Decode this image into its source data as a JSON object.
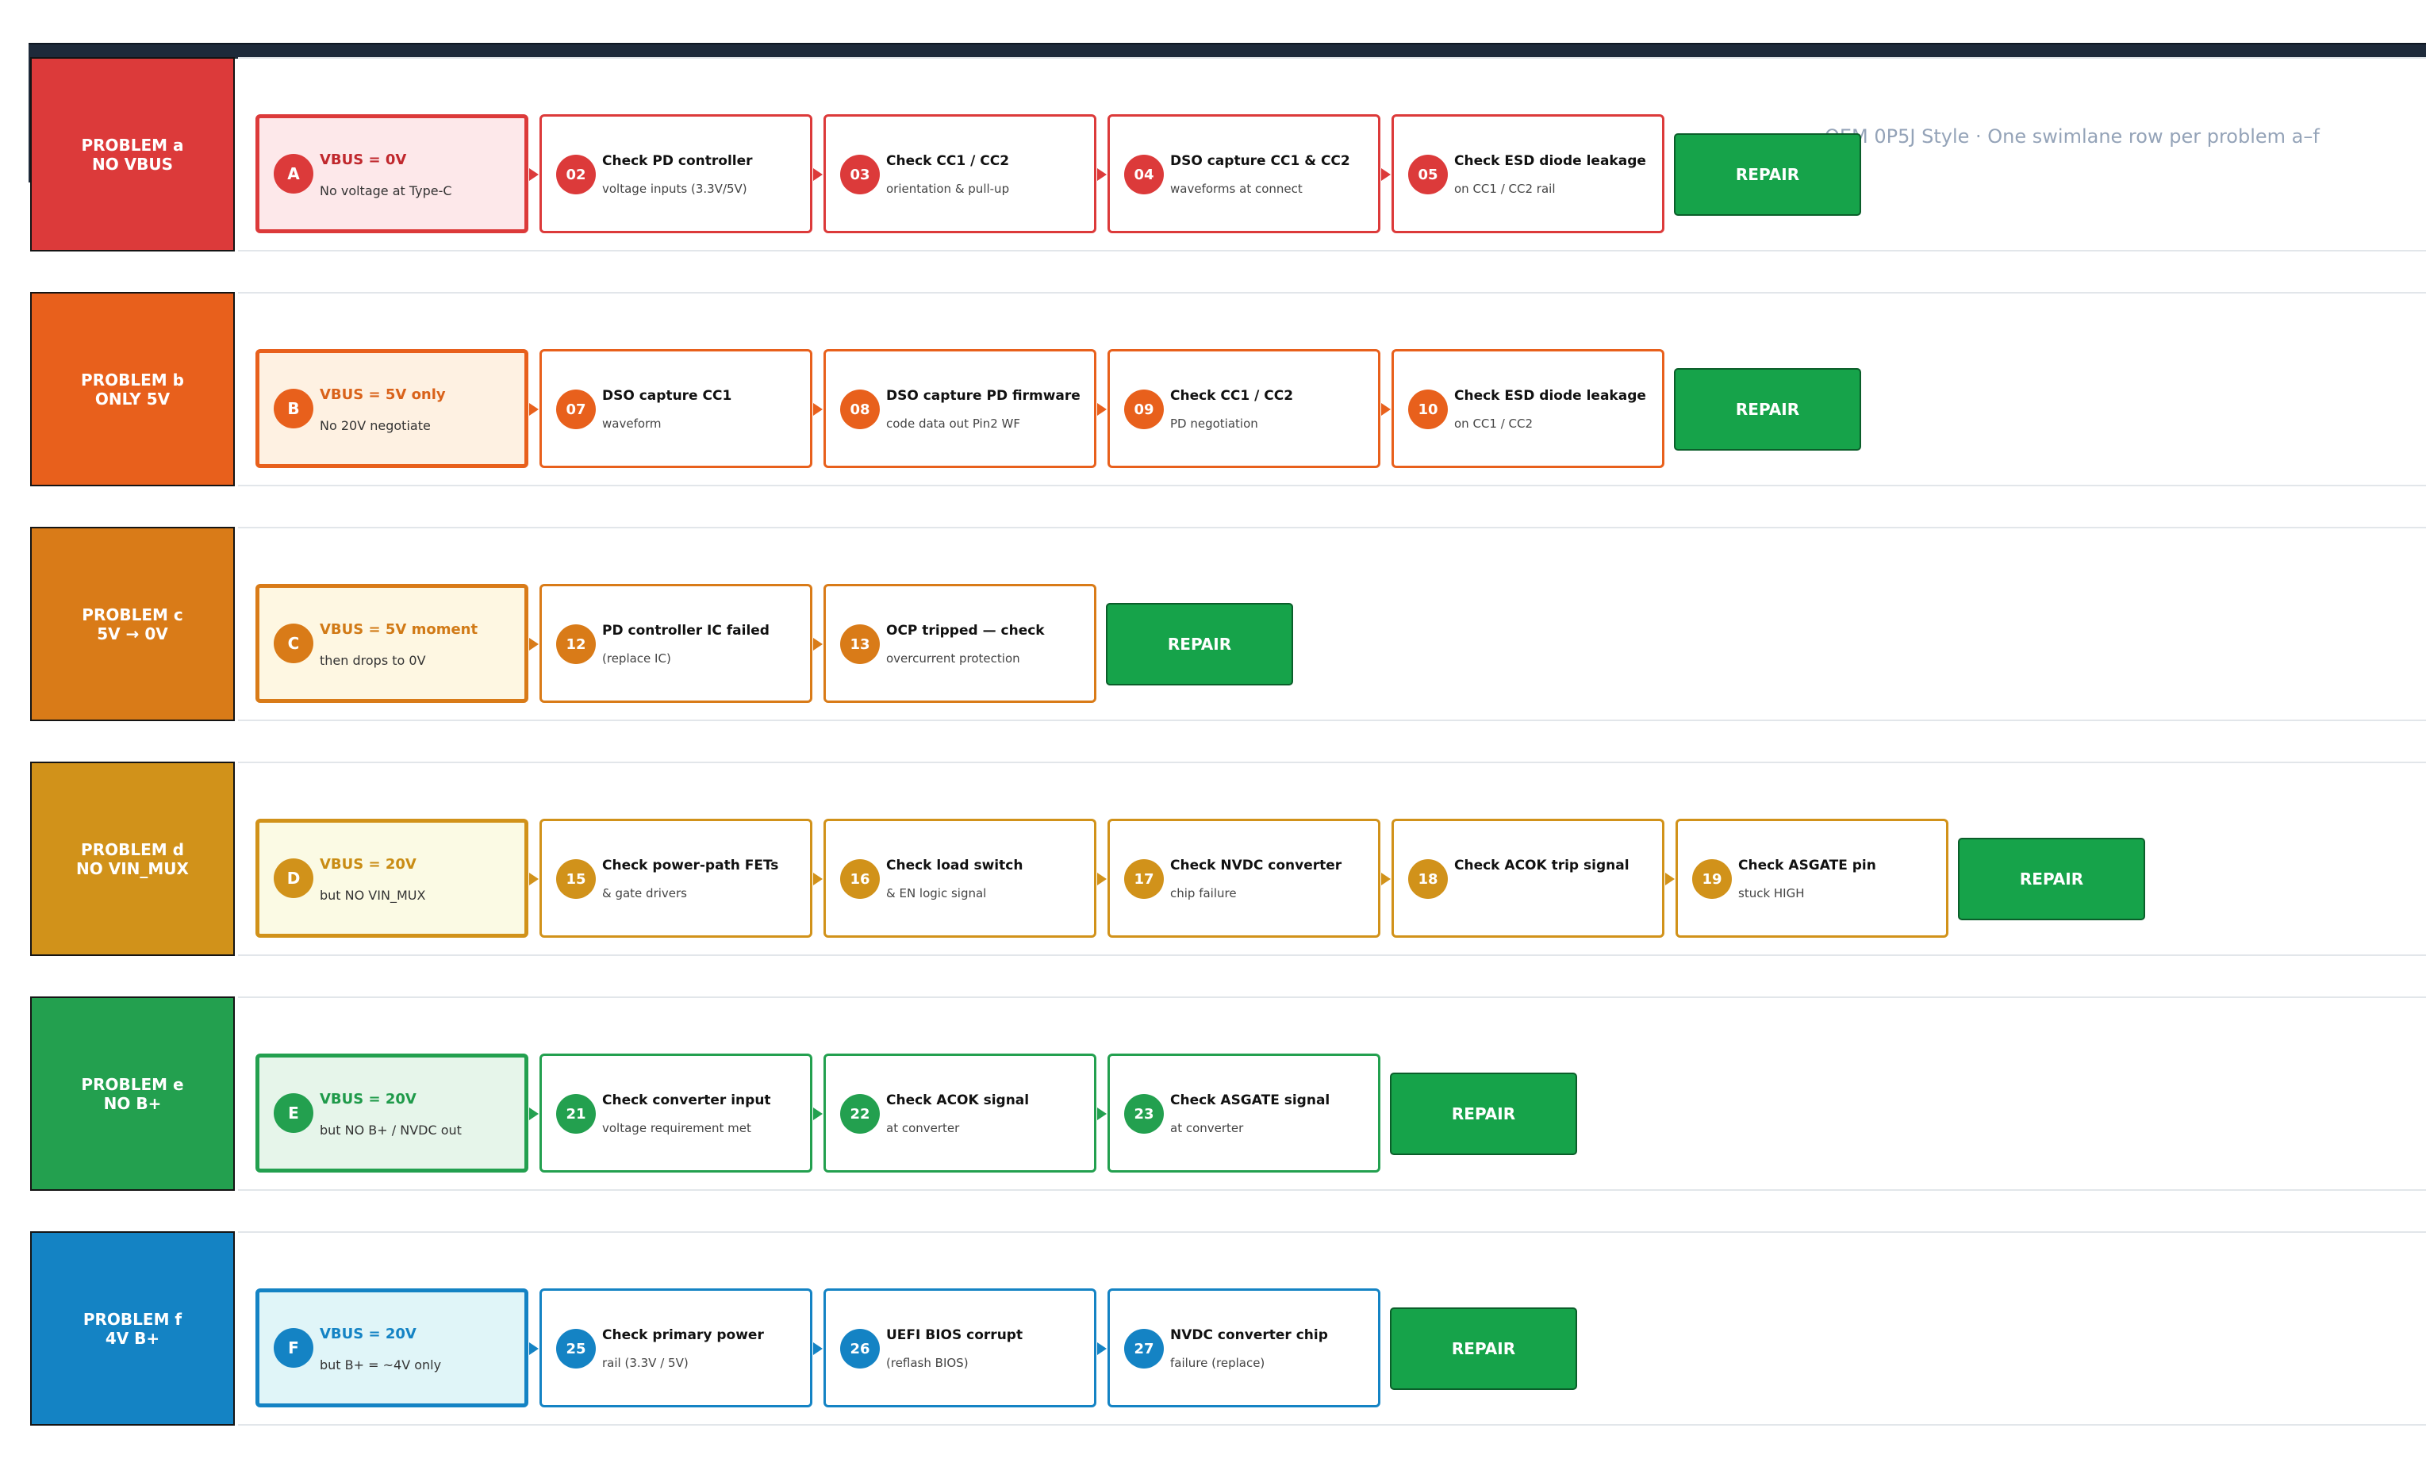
{
  "subtitle": "OEM 0P5J Style · One swimlane row per problem a–f",
  "repair_label": "REPAIR",
  "lanes": [
    {
      "id": "a",
      "color": "#dc3a3a",
      "label_line1": "PROBLEM a",
      "label_line2": "NO VBUS",
      "start": {
        "badge": "A",
        "title": "VBUS = 0V",
        "sub": "No voltage at Type-C",
        "bg": "#fde8ea",
        "text_color": "#c0282d"
      },
      "steps": [
        {
          "num": "02",
          "title": "Check PD controller",
          "sub": "voltage inputs (3.3V/5V)"
        },
        {
          "num": "03",
          "title": "Check CC1 / CC2",
          "sub": "orientation & pull-up"
        },
        {
          "num": "04",
          "title": "DSO capture CC1 & CC2",
          "sub": "waveforms at connect"
        },
        {
          "num": "05",
          "title": "Check ESD diode leakage",
          "sub": "on CC1 / CC2 rail"
        }
      ]
    },
    {
      "id": "b",
      "color": "#e8601c",
      "label_line1": "PROBLEM b",
      "label_line2": "ONLY 5V",
      "start": {
        "badge": "B",
        "title": "VBUS = 5V only",
        "sub": "No 20V negotiate",
        "bg": "#fef1e2",
        "text_color": "#d9621a"
      },
      "steps": [
        {
          "num": "07",
          "title": "DSO capture CC1",
          "sub": "waveform"
        },
        {
          "num": "08",
          "title": "DSO capture PD firmware",
          "sub": "code data out Pin2 WF"
        },
        {
          "num": "09",
          "title": "Check CC1 / CC2",
          "sub": "PD negotiation"
        },
        {
          "num": "10",
          "title": "Check ESD diode leakage",
          "sub": "on CC1 / CC2"
        }
      ]
    },
    {
      "id": "c",
      "color": "#d97b18",
      "label_line1": "PROBLEM c",
      "label_line2": "5V → 0V",
      "start": {
        "badge": "C",
        "title": "VBUS = 5V moment",
        "sub": "then drops to 0V",
        "bg": "#fef7e2",
        "text_color": "#d17a16"
      },
      "steps": [
        {
          "num": "12",
          "title": "PD controller IC failed",
          "sub": "(replace IC)"
        },
        {
          "num": "13",
          "title": "OCP tripped — check",
          "sub": "overcurrent protection"
        }
      ]
    },
    {
      "id": "d",
      "color": "#d1921a",
      "label_line1": "PROBLEM d",
      "label_line2": "NO VIN_MUX",
      "start": {
        "badge": "D",
        "title": "VBUS = 20V",
        "sub": "but NO VIN_MUX",
        "bg": "#fbfae4",
        "text_color": "#c98c14"
      },
      "steps": [
        {
          "num": "15",
          "title": "Check power-path FETs",
          "sub": "& gate drivers"
        },
        {
          "num": "16",
          "title": "Check load switch",
          "sub": "& EN logic signal"
        },
        {
          "num": "17",
          "title": "Check NVDC converter",
          "sub": "chip failure"
        },
        {
          "num": "18",
          "title": "Check ACOK trip signal",
          "sub": ""
        },
        {
          "num": "19",
          "title": "Check ASGATE pin",
          "sub": "stuck HIGH"
        }
      ]
    },
    {
      "id": "e",
      "color": "#23a04f",
      "label_line1": "PROBLEM e",
      "label_line2": "NO B+",
      "start": {
        "badge": "E",
        "title": "VBUS = 20V",
        "sub": "but NO B+ / NVDC out",
        "bg": "#e6f5ea",
        "text_color": "#1f9a4a"
      },
      "steps": [
        {
          "num": "21",
          "title": "Check converter input",
          "sub": "voltage requirement met"
        },
        {
          "num": "22",
          "title": "Check ACOK signal",
          "sub": "at converter"
        },
        {
          "num": "23",
          "title": "Check ASGATE signal",
          "sub": "at converter"
        }
      ]
    },
    {
      "id": "f",
      "color": "#1483c4",
      "label_line1": "PROBLEM f",
      "label_line2": "4V B+",
      "start": {
        "badge": "F",
        "title": "VBUS = 20V",
        "sub": "but B+ = ~4V only",
        "bg": "#e0f5f8",
        "text_color": "#1483c4"
      },
      "steps": [
        {
          "num": "25",
          "title": "Check primary power",
          "sub": "rail (3.3V / 5V)"
        },
        {
          "num": "26",
          "title": "UEFI BIOS corrupt",
          "sub": "(reflash BIOS)"
        },
        {
          "num": "27",
          "title": "NVDC converter chip",
          "sub": "failure (replace)"
        }
      ]
    }
  ]
}
